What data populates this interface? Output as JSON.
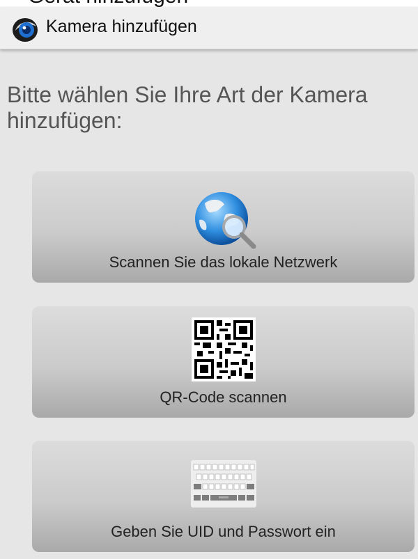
{
  "status_bar": {
    "partial_text": "Gerät hinzufügen"
  },
  "app_bar": {
    "title": "Kamera hinzufügen",
    "logo_icon": "eye-camera-logo-icon"
  },
  "prompt": "Bitte wählen Sie Ihre Art der Kamera hinzufügen:",
  "options": [
    {
      "label": "Scannen Sie das lokale Netzwerk",
      "icon": "globe-search-icon"
    },
    {
      "label": "QR-Code scannen",
      "icon": "qr-code-icon"
    },
    {
      "label": "Geben Sie UID und Passwort ein",
      "icon": "keyboard-icon"
    }
  ],
  "colors": {
    "background": "#e6e6e6",
    "app_bar": "#efefef",
    "prompt_text": "#555555",
    "button_top": "#dcdcdc",
    "button_bottom": "#a9a9a9",
    "logo_blue": "#1f6fd1"
  }
}
